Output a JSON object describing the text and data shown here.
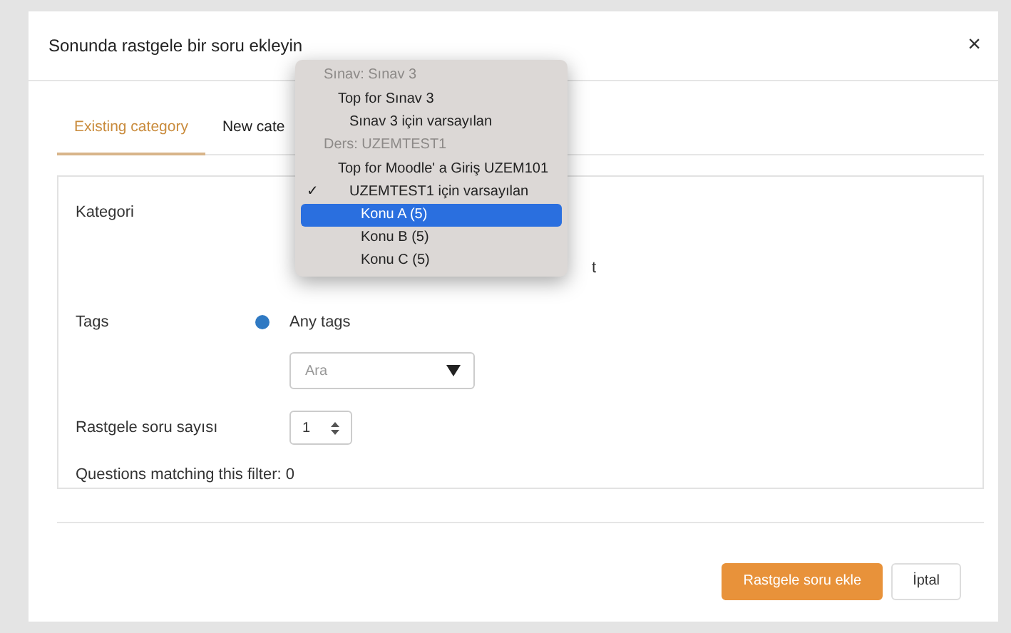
{
  "dialog": {
    "title": "Sonunda rastgele bir soru ekleyin",
    "close": "×"
  },
  "tabs": [
    {
      "label": "Existing category",
      "selected": true
    },
    {
      "label": "New cate",
      "selected": false
    }
  ],
  "form": {
    "category_label": "Kategori",
    "hidden_text": "t",
    "tags_label": "Tags",
    "tags_value": "Any tags",
    "tags_search": {
      "placeholder": "Ara"
    },
    "count_label": "Rastgele soru sayısı",
    "count_value": "1",
    "matching": "Questions matching this filter: 0"
  },
  "checkmark": "✓",
  "dropdown": [
    {
      "heading": "Sınav: Sınav 3",
      "items": [
        {
          "label": "Top for Sınav 3",
          "checked": false,
          "selected": false,
          "children": [
            {
              "label": "Sınav 3 için varsayılan",
              "checked": false,
              "selected": false
            }
          ]
        }
      ]
    },
    {
      "heading": "Ders: UZEMTEST1",
      "items": [
        {
          "label": "Top for Moodle' a Giriş UZEM101",
          "checked": false,
          "selected": false,
          "children": [
            {
              "label": "UZEMTEST1 için varsayılan",
              "checked": true,
              "selected": false,
              "children": [
                {
                  "label": "Konu A (5)",
                  "checked": false,
                  "selected": true
                },
                {
                  "label": "Konu B (5)",
                  "checked": false,
                  "selected": false
                },
                {
                  "label": "Konu C (5)",
                  "checked": false,
                  "selected": false
                }
              ]
            }
          ]
        }
      ]
    }
  ],
  "buttons": [
    {
      "label": "Rastgele soru ekle",
      "kind": "primary"
    },
    {
      "label": "İptal",
      "kind": "secondary"
    }
  ]
}
